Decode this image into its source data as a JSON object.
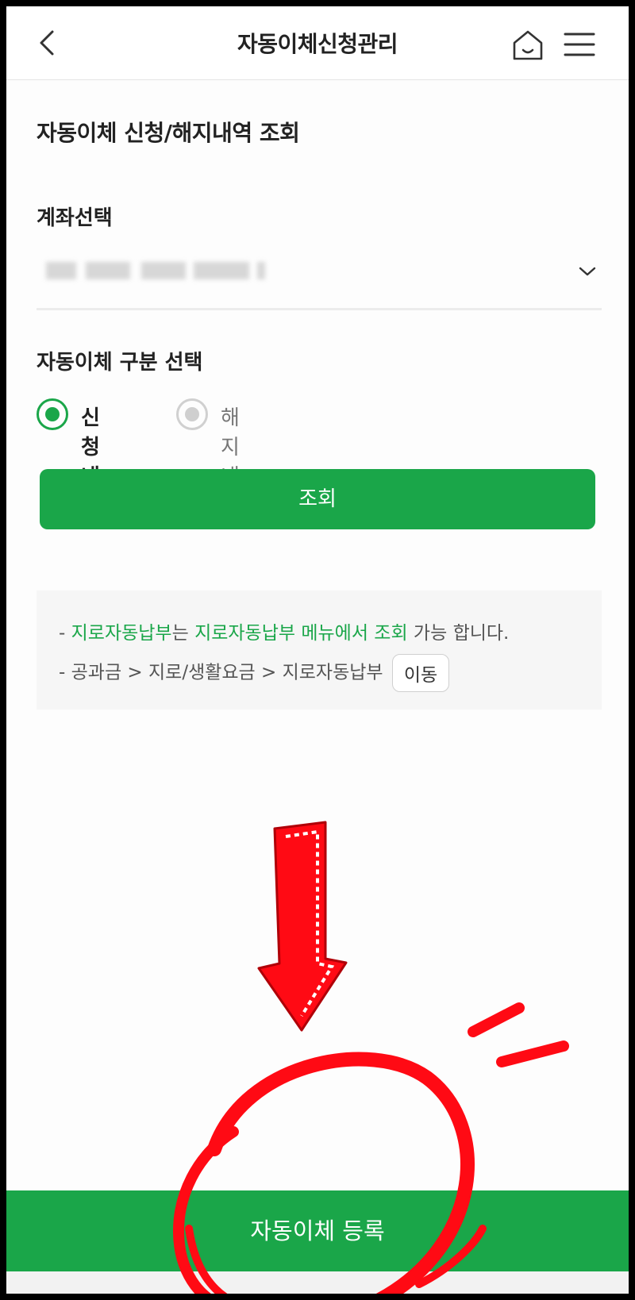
{
  "header": {
    "title": "자동이체신청관리",
    "icons": [
      "back-arrow-icon",
      "home-icon",
      "hamburger-menu-icon"
    ]
  },
  "section_title": "자동이체 신청/해지내역 조회",
  "account": {
    "label": "계좌선택",
    "selected_value_masked": true
  },
  "type_select": {
    "label": "자동이체 구분 선택",
    "options": [
      {
        "label": "신청내역",
        "selected": true
      },
      {
        "label": "해지내역",
        "selected": false
      }
    ]
  },
  "query_button": "조회",
  "notice": {
    "line1": {
      "prefix": "- ",
      "green1": "지로자동납부",
      "mid": "는 ",
      "green2": "지로자동납부 메뉴에서 조회",
      "suffix": " 가능 합니다."
    },
    "line2": {
      "prefix": "- ",
      "path": "공과금 > 지로/생활요금 > 지로자동납부",
      "button": "이동"
    }
  },
  "bottom_button": "자동이체 등록",
  "colors": {
    "accent": "#1aa649",
    "annotation": "#ff0a14"
  }
}
